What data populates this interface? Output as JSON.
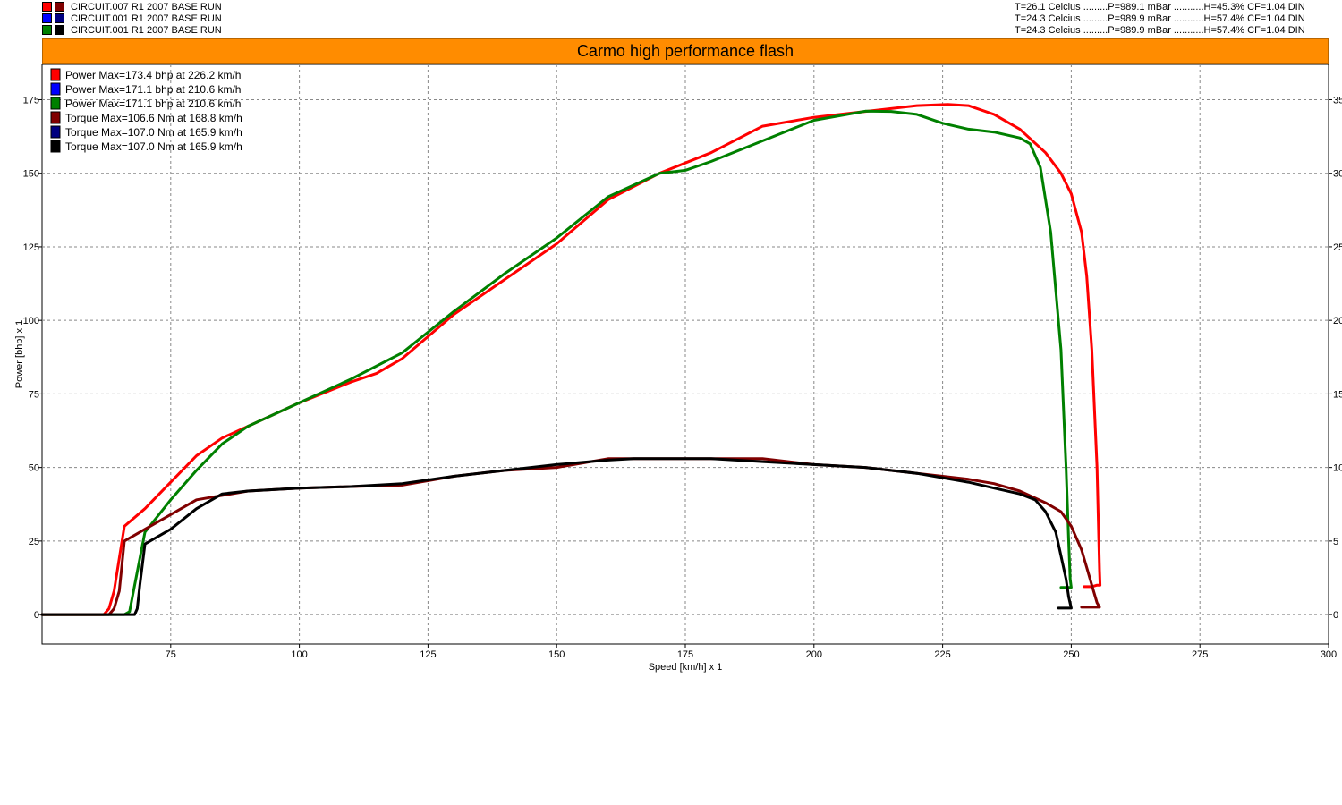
{
  "runs": [
    {
      "label": "CIRCUIT.007 R1 2007   BASE RUN",
      "colors": [
        "#ff0000",
        "#800000"
      ]
    },
    {
      "label": "CIRCUIT.001 R1 2007   BASE RUN",
      "colors": [
        "#0000ff",
        "#000080"
      ]
    },
    {
      "label": "CIRCUIT.001 R1 2007   BASE RUN",
      "colors": [
        "#008000",
        "#000000"
      ]
    }
  ],
  "conditions": [
    "T=26.1 Celcius .........P=989.1 mBar ...........H=45.3% CF=1.04 DIN",
    "T=24.3 Celcius .........P=989.9 mBar ...........H=57.4% CF=1.04 DIN",
    "T=24.3 Celcius .........P=989.9 mBar ...........H=57.4% CF=1.04 DIN"
  ],
  "chart_data": {
    "type": "line",
    "title": "Carmo high performance flash",
    "xlabel": "Speed [km/h] x 1",
    "ylabel": "Power [bhp] x 1",
    "xlim": [
      50,
      300
    ],
    "ylim": [
      -10,
      187
    ],
    "y2lim": [
      -2,
      37.4
    ],
    "x_ticks": [
      75,
      100,
      125,
      150,
      175,
      200,
      225,
      250,
      275,
      300
    ],
    "y_ticks": [
      0,
      25,
      50,
      75,
      100,
      125,
      150,
      175
    ],
    "y2_ticks": [
      0,
      5,
      10,
      15,
      20,
      25,
      30,
      35
    ],
    "grid": true,
    "legend_position": "top-left",
    "legend": [
      {
        "text": "Power  Max=173.4 bhp at 226.2 km/h",
        "color": "#ff0000"
      },
      {
        "text": "Power  Max=171.1 bhp at 210.6 km/h",
        "color": "#0000ff"
      },
      {
        "text": "Power  Max=171.1 bhp at 210.6 km/h",
        "color": "#008000"
      },
      {
        "text": "Torque  Max=106.6 Nm at 168.8 km/h",
        "color": "#800000"
      },
      {
        "text": "Torque  Max=107.0 Nm at 165.9 km/h",
        "color": "#000080"
      },
      {
        "text": "Torque  Max=107.0 Nm at 165.9 km/h",
        "color": "#000000"
      }
    ],
    "series": [
      {
        "color": "#ff0000",
        "x": [
          50,
          62,
          63,
          64,
          66,
          70,
          75,
          80,
          85,
          90,
          100,
          110,
          115,
          120,
          130,
          140,
          150,
          160,
          170,
          180,
          190,
          200,
          210,
          220,
          226,
          230,
          235,
          240,
          245,
          248,
          250,
          252,
          253,
          254,
          255,
          255.5,
          255.6,
          255,
          254,
          252.5
        ],
        "y": [
          0,
          0,
          2,
          8,
          30,
          36,
          45,
          54,
          60,
          64,
          72,
          79,
          82,
          87,
          102,
          114,
          126,
          141,
          150,
          157,
          166,
          169,
          171,
          173,
          173.4,
          173,
          170,
          165,
          157,
          150,
          143,
          130,
          115,
          90,
          50,
          15,
          10,
          10,
          9.5,
          9.5
        ]
      },
      {
        "color": "#008000",
        "x": [
          50,
          66,
          67,
          68,
          70,
          75,
          80,
          85,
          90,
          100,
          110,
          120,
          130,
          140,
          150,
          160,
          170,
          175,
          180,
          190,
          200,
          210,
          215,
          220,
          225,
          230,
          235,
          240,
          242,
          244,
          246,
          248,
          249,
          249.5,
          249.8,
          250,
          249.8,
          249,
          248
        ],
        "y": [
          0,
          0,
          1,
          10,
          28,
          39,
          49,
          58,
          64,
          72,
          80,
          89,
          103,
          116,
          128,
          142,
          150,
          151,
          154,
          161,
          168,
          171.1,
          171,
          170,
          167,
          165,
          164,
          162,
          160,
          152,
          130,
          90,
          50,
          25,
          12,
          9.2,
          9.2,
          9.2,
          9.2
        ]
      },
      {
        "color": "#800000",
        "x": [
          50,
          63,
          64,
          65,
          66,
          70,
          75,
          80,
          90,
          100,
          110,
          120,
          130,
          140,
          150,
          160,
          170,
          180,
          190,
          200,
          210,
          220,
          230,
          235,
          240,
          245,
          248,
          250,
          252,
          253,
          254,
          255,
          255.5,
          255,
          254,
          252
        ],
        "y": [
          0,
          0,
          2,
          8,
          25,
          29,
          34,
          39,
          42,
          43,
          43.5,
          44,
          47,
          49,
          50,
          53,
          53,
          53,
          53,
          51,
          50,
          48,
          46,
          44.5,
          42,
          38,
          35,
          30,
          22,
          16,
          10,
          4,
          2.5,
          2.5,
          2.5,
          2.5
        ]
      },
      {
        "color": "#000000",
        "x": [
          50,
          68,
          68.5,
          69,
          70,
          75,
          80,
          85,
          90,
          100,
          110,
          120,
          130,
          140,
          150,
          160,
          165,
          170,
          180,
          190,
          200,
          210,
          220,
          230,
          235,
          240,
          243,
          245,
          247,
          248,
          249,
          249.5,
          250,
          249.5,
          248.5,
          247.5
        ],
        "y": [
          0,
          0,
          2,
          10,
          24,
          29,
          36,
          41,
          42,
          43,
          43.5,
          44.5,
          47,
          49,
          51,
          52.5,
          53,
          53,
          53,
          52,
          51,
          50,
          48,
          45,
          43,
          41,
          39,
          35,
          28,
          20,
          12,
          6,
          2.2,
          2.2,
          2.2,
          2.2
        ]
      }
    ]
  }
}
